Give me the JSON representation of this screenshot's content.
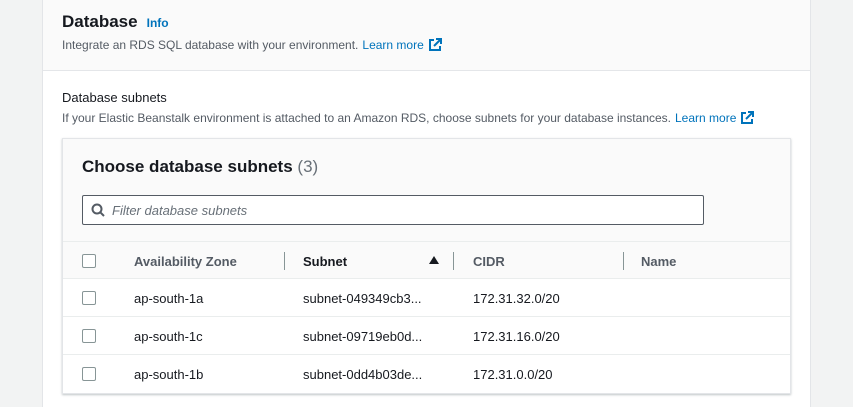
{
  "header": {
    "title": "Database",
    "info": "Info",
    "description": "Integrate an RDS SQL database with your environment.",
    "learn_more": "Learn more"
  },
  "subnets_section": {
    "label": "Database subnets",
    "description": "If your Elastic Beanstalk environment is attached to an Amazon RDS, choose subnets for your database instances.",
    "learn_more": "Learn more"
  },
  "table": {
    "title": "Choose database subnets",
    "count": "(3)",
    "filter_placeholder": "Filter database subnets",
    "columns": [
      "Availability Zone",
      "Subnet",
      "CIDR",
      "Name"
    ],
    "sorted_column": "Subnet",
    "sort_direction": "ascending",
    "rows": [
      {
        "az": "ap-south-1a",
        "subnet": "subnet-049349cb3...",
        "cidr": "172.31.32.0/20",
        "name": "",
        "checked": false
      },
      {
        "az": "ap-south-1c",
        "subnet": "subnet-09719eb0d...",
        "cidr": "172.31.16.0/20",
        "name": "",
        "checked": false
      },
      {
        "az": "ap-south-1b",
        "subnet": "subnet-0dd4b03de...",
        "cidr": "172.31.0.0/20",
        "name": "",
        "checked": false
      }
    ]
  },
  "colors": {
    "link": "#0073bb",
    "text": "#16191f",
    "muted": "#545b64",
    "background": "#f2f3f3"
  }
}
